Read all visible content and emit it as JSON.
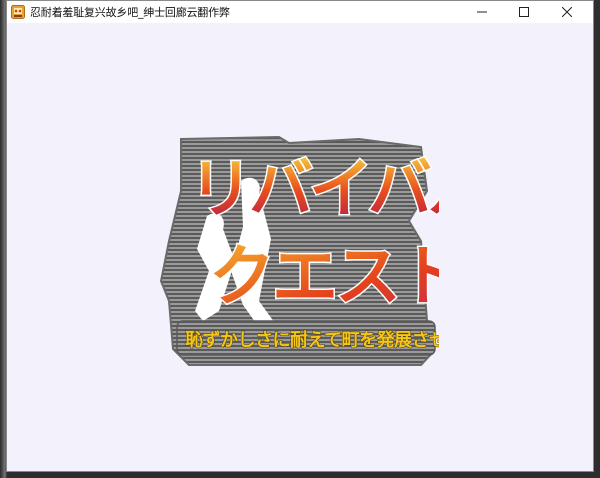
{
  "window": {
    "title": "忍耐着羞耻复兴故乡吧_绅士回廊云翻作弊"
  },
  "logo": {
    "title_line1": "リバイバル",
    "title_line2": "クエスト",
    "subtitle": "恥ずかしさに耐えて町を発展させる"
  },
  "icons": {
    "app": "app-icon",
    "minimize": "minimize-icon",
    "maximize": "maximize-icon",
    "close": "close-icon"
  },
  "colors": {
    "title_gradient_top": "#f7c23a",
    "title_gradient_mid": "#e8501e",
    "title_gradient_bottom": "#9a1a5a",
    "subtitle_fill": "#f5c518",
    "logo_outline": "#6a6a6a"
  }
}
